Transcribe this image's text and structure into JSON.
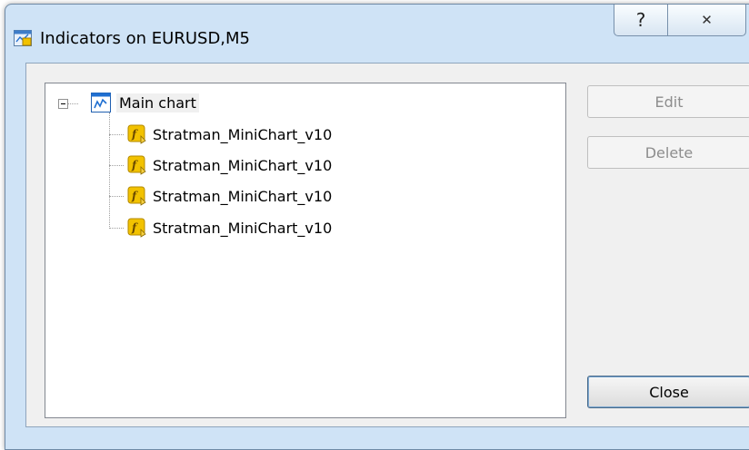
{
  "window": {
    "title": "Indicators on EURUSD,M5",
    "help_glyph": "?",
    "close_glyph": "✕"
  },
  "tree": {
    "root": {
      "label": "Main chart",
      "icon": "chart-window-icon",
      "expanded": true
    },
    "children": [
      {
        "label": "Stratman_MiniChart_v10",
        "icon": "custom-indicator-icon"
      },
      {
        "label": "Stratman_MiniChart_v10",
        "icon": "custom-indicator-icon"
      },
      {
        "label": "Stratman_MiniChart_v10",
        "icon": "custom-indicator-icon"
      },
      {
        "label": "Stratman_MiniChart_v10",
        "icon": "custom-indicator-icon"
      }
    ]
  },
  "buttons": {
    "edit": {
      "label": "Edit",
      "enabled": false
    },
    "delete": {
      "label": "Delete",
      "enabled": false
    },
    "close": {
      "label": "Close",
      "enabled": true
    }
  },
  "colors": {
    "frame": "#cfe3f6",
    "icon_yellow": "#f2c200",
    "chart_blue": "#1f6fd1"
  }
}
